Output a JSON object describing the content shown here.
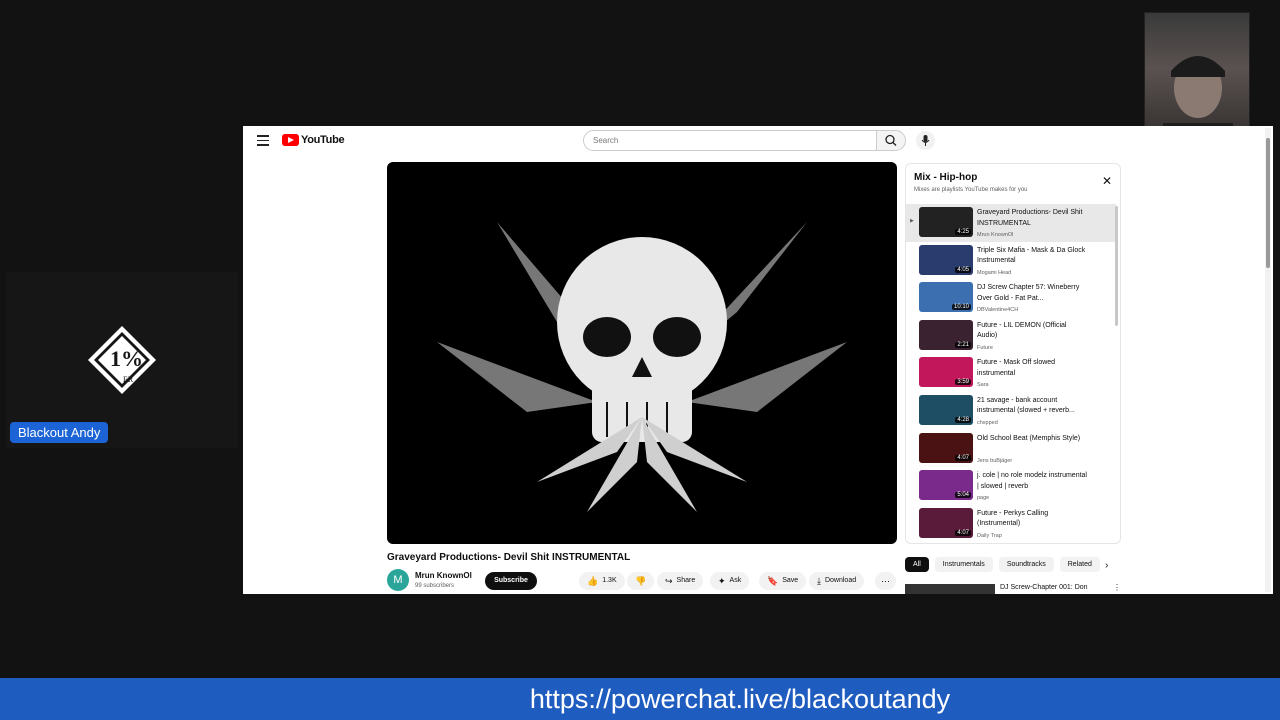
{
  "streamer": {
    "name": "Blackout Andy",
    "logo_text": "1%",
    "logo_sub": "ER"
  },
  "youtube": {
    "logo_text": "YouTube",
    "search_placeholder": "Search",
    "video_title": "Graveyard Productions- Devil Shit INSTRUMENTAL",
    "channel": {
      "avatar_letter": "M",
      "name": "Mrun KnownOl",
      "subscribers": "99 subscribers"
    },
    "subscribe_label": "Subscribe",
    "actions": {
      "likes": "1.3K",
      "share": "Share",
      "ask": "Ask",
      "save": "Save",
      "download": "Download"
    },
    "mix": {
      "title": "Mix - Hip-hop",
      "subtitle": "Mixes are playlists YouTube makes for you",
      "items": [
        {
          "title": "Graveyard Productions- Devil Shit INSTRUMENTAL",
          "channel": "Mrun KnownOl",
          "duration": "4:25",
          "color": "#222222"
        },
        {
          "title": "Triple Six Mafia - Mask & Da Glock Instrumental",
          "channel": "Mogami Head",
          "duration": "4:05",
          "color": "#2a3b6d"
        },
        {
          "title": "DJ Screw Chapter 57: Wineberry Over Gold - Fat Pat...",
          "channel": "DBValentine4CH",
          "duration": "10:10",
          "color": "#3c6fb0"
        },
        {
          "title": "Future - LIL DEMON (Official Audio)",
          "channel": "Future",
          "duration": "2:21",
          "color": "#3b2230"
        },
        {
          "title": "Future - Mask Off slowed instrumental",
          "channel": "Sara",
          "duration": "3:59",
          "color": "#c2185b"
        },
        {
          "title": "21 savage - bank account instrumental (slowed + reverb...",
          "channel": "chxpped",
          "duration": "4:28",
          "color": "#1d4e63"
        },
        {
          "title": "Old School Beat (Memphis Style)",
          "channel": "Jens buBjäger",
          "duration": "4:07",
          "color": "#4a1212"
        },
        {
          "title": "j. cole | no role modelz instrumental | slowed | reverb",
          "channel": "page",
          "duration": "5:04",
          "color": "#7a2a8a"
        },
        {
          "title": "Future - Perkys Calling (Instrumental)",
          "channel": "Daily Trap",
          "duration": "4:07",
          "color": "#5a1a3a"
        }
      ]
    },
    "chips": [
      "All",
      "Instrumentals",
      "Soundtracks",
      "Related"
    ],
    "related_title": "DJ Screw-Chapter 001: Don"
  },
  "footer_url": "https://powerchat.live/blackoutandy"
}
